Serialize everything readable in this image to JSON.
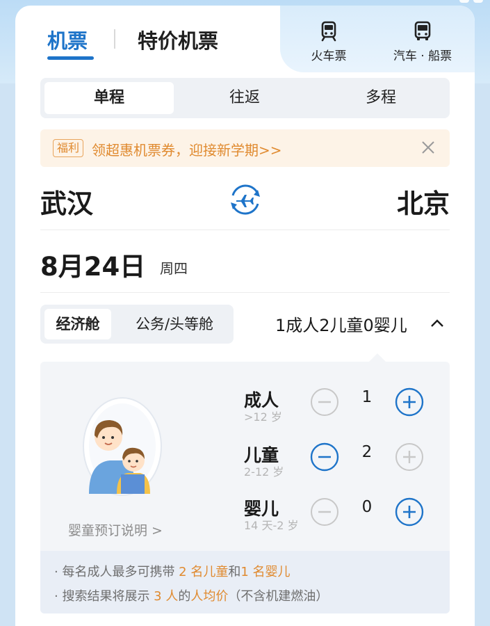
{
  "header": {
    "tab_flight": "机票",
    "tab_special": "特价机票",
    "train_label": "火车票",
    "bus_label": "汽车 · 船票"
  },
  "trip_types": [
    "单程",
    "往返",
    "多程"
  ],
  "promo": {
    "badge": "福利",
    "text": "领超惠机票券，迎接新学期>>"
  },
  "route": {
    "from": "武汉",
    "to": "北京"
  },
  "date": {
    "day": "8月24日",
    "weekday": "周四"
  },
  "cabin": {
    "economy": "经济舱",
    "business": "公务/头等舱"
  },
  "passengers": {
    "summary": "1成人2儿童0婴儿",
    "adult": {
      "label": "成人",
      "age": ">12 岁",
      "count": "1"
    },
    "child": {
      "label": "儿童",
      "age": "2-12 岁",
      "count": "2"
    },
    "infant": {
      "label": "婴儿",
      "age": "14 天-2 岁",
      "count": "0"
    },
    "infant_info_link": "婴童预订说明 >"
  },
  "notes": {
    "line1": {
      "prefix": "· 每名成人最多可携带 ",
      "hl1": "2 名儿童",
      "mid": "和",
      "hl2": "1 名婴儿"
    },
    "line2": {
      "prefix": "· 搜索结果将展示 ",
      "hl1": "3 人",
      "mid": "的",
      "hl2": "人均价",
      "suffix": "（不含机建燃油）"
    }
  },
  "colors": {
    "accent": "#1e74c9",
    "orange": "#e08a2f",
    "disabled": "#c8c8c8"
  }
}
